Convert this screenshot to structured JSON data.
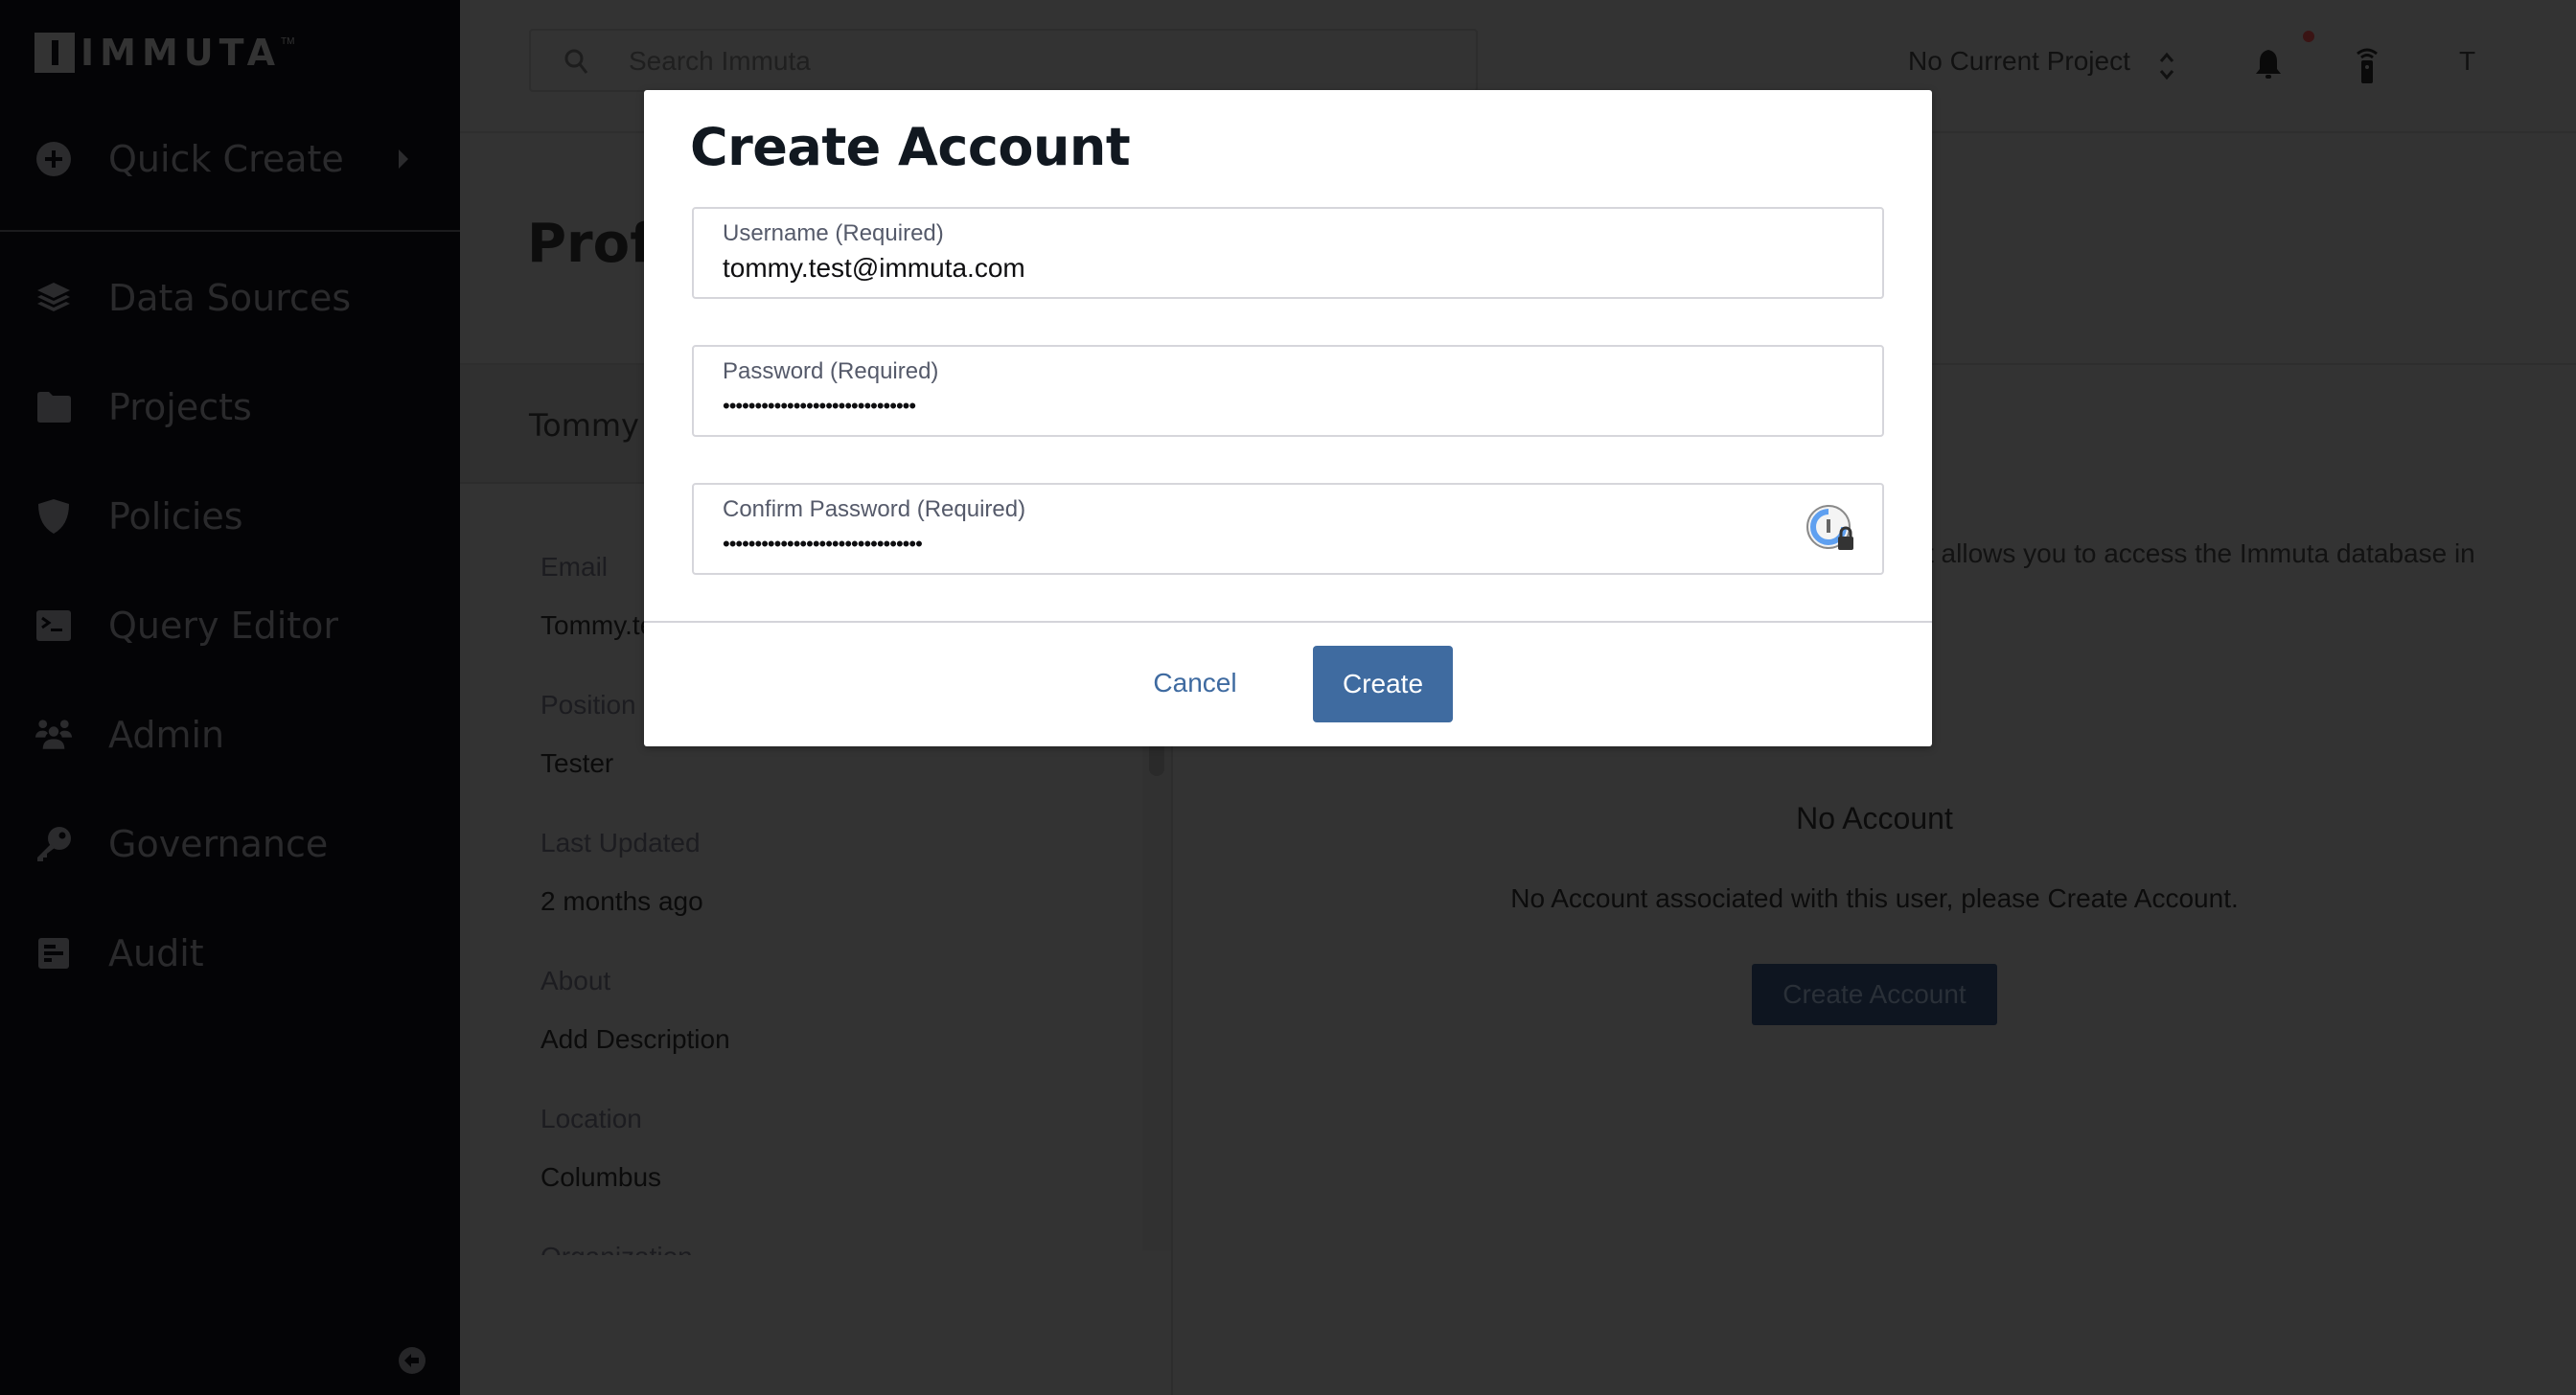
{
  "brand": {
    "name": "IMMUTA",
    "trademark": "TM"
  },
  "sidebar": {
    "quick_create": {
      "label": "Quick Create",
      "icon": "plus-circle-icon"
    },
    "items": [
      {
        "label": "Data Sources",
        "icon": "layers-icon"
      },
      {
        "label": "Projects",
        "icon": "folder-icon"
      },
      {
        "label": "Policies",
        "icon": "shield-icon"
      },
      {
        "label": "Query Editor",
        "icon": "terminal-icon"
      },
      {
        "label": "Admin",
        "icon": "users-icon"
      },
      {
        "label": "Governance",
        "icon": "key-icon"
      },
      {
        "label": "Audit",
        "icon": "report-icon"
      }
    ],
    "collapse_icon": "arrow-left-circle-icon"
  },
  "header": {
    "search": {
      "placeholder": "Search Immuta",
      "value": ""
    },
    "project_selector": "No Current Project",
    "avatar_initial": "T",
    "notification_dot": true
  },
  "page": {
    "title": "Profile",
    "user_name": "Tommy Test",
    "fields": [
      {
        "label": "Email",
        "value": "Tommy.test@immuta.com"
      },
      {
        "label": "Position",
        "value": "Tester"
      },
      {
        "label": "Last Updated",
        "value": "2 months ago"
      },
      {
        "label": "About",
        "value": "Add Description"
      },
      {
        "label": "Location",
        "value": "Columbus"
      },
      {
        "label": "Organization",
        "value": ""
      }
    ],
    "account_description_partial": "t allows you to access the Immuta database in",
    "no_account": {
      "title": "No Account",
      "message": "No Account associated with this user, please Create Account.",
      "button": "Create Account"
    }
  },
  "modal": {
    "title": "Create Account",
    "fields": {
      "username": {
        "label": "Username (Required)",
        "value": "tommy.test@immuta.com"
      },
      "password": {
        "label": "Password (Required)",
        "value": "••••••••••••••••••••••••••••••"
      },
      "confirm_password": {
        "label": "Confirm Password (Required)",
        "value": "•••••••••••••••••••••••••••••••"
      }
    },
    "cancel_label": "Cancel",
    "create_label": "Create"
  },
  "colors": {
    "primary": "#3f6ba0",
    "link": "#3e6aa0",
    "sidebar_bg": "#040406",
    "overlay_bg": "#333333"
  }
}
